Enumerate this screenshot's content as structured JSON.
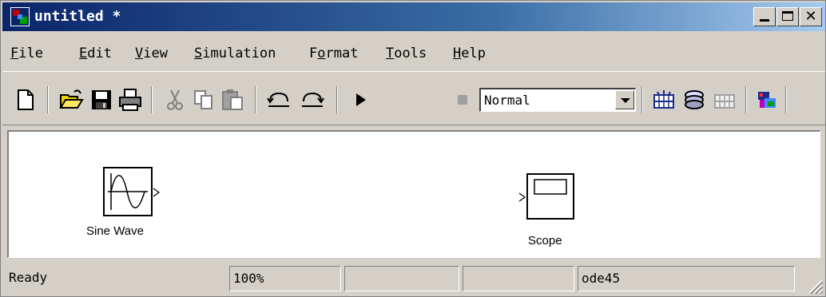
{
  "window": {
    "title": "untitled *"
  },
  "menu": [
    {
      "hotkey": "F",
      "rest": "ile"
    },
    {
      "hotkey": "E",
      "rest": "dit"
    },
    {
      "hotkey": "V",
      "rest": "iew"
    },
    {
      "hotkey": "S",
      "rest": "imulation"
    },
    {
      "hotkey": "F",
      "rest": "o",
      "hotkey_index": 1,
      "full": "Format"
    },
    {
      "hotkey": "T",
      "rest": "ools"
    },
    {
      "hotkey": "H",
      "rest": "elp"
    }
  ],
  "toolbar": {
    "sim_mode": "Normal",
    "icons": [
      "new-model-icon",
      "open-icon",
      "save-icon",
      "print-icon",
      "cut-icon",
      "copy-icon",
      "paste-icon",
      "undo-icon",
      "redo-icon",
      "start-simulation-icon",
      "stop-simulation-icon",
      "library-browser-icon",
      "build-icon",
      "update-diagram-icon",
      "model-explorer-icon"
    ]
  },
  "canvas": {
    "blocks": [
      {
        "name": "Sine Wave"
      },
      {
        "name": "Scope"
      }
    ]
  },
  "status": {
    "state": "Ready",
    "zoom": "100%",
    "pane3": "",
    "pane4": "",
    "solver": "ode45"
  },
  "colors": {
    "titlebar_start": "#0a246a",
    "titlebar_end": "#a6caf0",
    "face": "#d4d0c8"
  }
}
